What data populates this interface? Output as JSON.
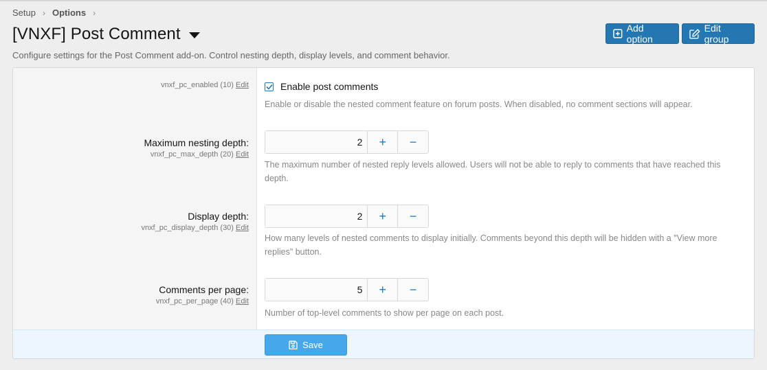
{
  "breadcrumb": {
    "items": [
      "Setup",
      "Options"
    ],
    "separator": "›"
  },
  "header": {
    "title": "[VNXF] Post Comment",
    "description": "Configure settings for the Post Comment add-on. Control nesting depth, display levels, and comment behavior.",
    "add_option_label": "Add option",
    "edit_group_label": "Edit group"
  },
  "options": {
    "enabled": {
      "key": "vnxf_pc_enabled (10)",
      "edit": "Edit",
      "checkbox_label": "Enable post comments",
      "checked": true,
      "hint": "Enable or disable the nested comment feature on forum posts. When disabled, no comment sections will appear."
    },
    "max_depth": {
      "label": "Maximum nesting depth:",
      "key": "vnxf_pc_max_depth (20)",
      "edit": "Edit",
      "value": "2",
      "plus": "+",
      "minus": "−",
      "hint": "The maximum number of nested reply levels allowed. Users will not be able to reply to comments that have reached this depth."
    },
    "display_depth": {
      "label": "Display depth:",
      "key": "vnxf_pc_display_depth (30)",
      "edit": "Edit",
      "value": "2",
      "plus": "+",
      "minus": "−",
      "hint": "How many levels of nested comments to display initially. Comments beyond this depth will be hidden with a \"View more replies\" button."
    },
    "per_page": {
      "label": "Comments per page:",
      "key": "vnxf_pc_per_page (40)",
      "edit": "Edit",
      "value": "5",
      "plus": "+",
      "minus": "−",
      "hint": "Number of top-level comments to show per page on each post."
    }
  },
  "footer": {
    "save_label": "Save"
  },
  "icons": {
    "add": "plus-square-icon",
    "edit": "edit-icon",
    "save": "save-icon",
    "caret": "caret-down-icon",
    "check": "check-icon"
  },
  "colors": {
    "primary": "#2577b1",
    "save": "#47a7eb",
    "footer_bg": "#edf6fd",
    "label_bg": "#f5f5f5",
    "page_bg": "#eeeeee"
  }
}
